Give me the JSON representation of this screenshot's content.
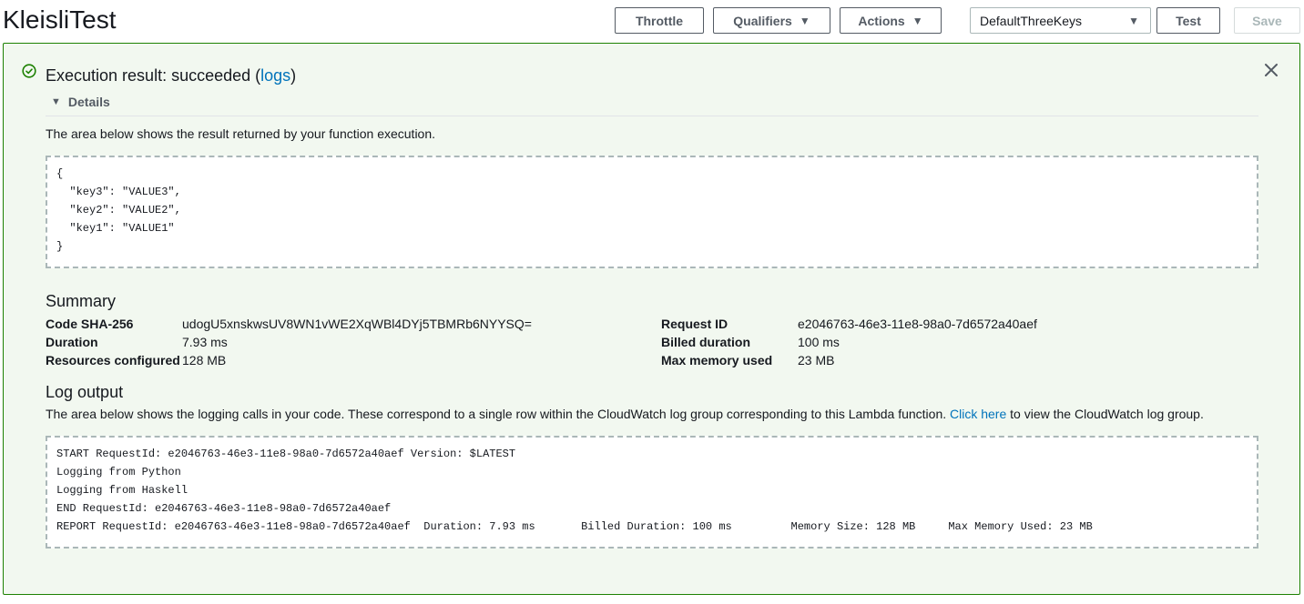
{
  "header": {
    "title": "KleisliTest",
    "throttle_label": "Throttle",
    "qualifiers_label": "Qualifiers",
    "actions_label": "Actions",
    "test_event_selected": "DefaultThreeKeys",
    "test_label": "Test",
    "save_label": "Save"
  },
  "result": {
    "title_prefix": "Execution result: succeeded (",
    "logs_link": "logs",
    "title_suffix": ")",
    "details_label": "Details",
    "status_color": "#1d8102",
    "description": "The area below shows the result returned by your function execution.",
    "output_lines": [
      "{",
      "  \"key3\": \"VALUE3\",",
      "  \"key2\": \"VALUE2\",",
      "  \"key1\": \"VALUE1\"",
      "}"
    ]
  },
  "summary": {
    "title": "Summary",
    "left": [
      {
        "key": "Code SHA-256",
        "value": "udogU5xnskwsUV8WN1vWE2XqWBl4DYj5TBMRb6NYYSQ="
      },
      {
        "key": "Duration",
        "value": "7.93 ms"
      },
      {
        "key": "Resources configured",
        "value": "128 MB"
      }
    ],
    "right": [
      {
        "key": "Request ID",
        "value": "e2046763-46e3-11e8-98a0-7d6572a40aef"
      },
      {
        "key": "Billed duration",
        "value": "100 ms"
      },
      {
        "key": "Max memory used",
        "value": "23 MB"
      }
    ]
  },
  "log_output": {
    "title": "Log output",
    "description_prefix": "The area below shows the logging calls in your code. These correspond to a single row within the CloudWatch log group corresponding to this Lambda function. ",
    "link_text": "Click here",
    "description_suffix": " to view the CloudWatch log group.",
    "lines": [
      "START RequestId: e2046763-46e3-11e8-98a0-7d6572a40aef Version: $LATEST",
      "Logging from Python",
      "Logging from Haskell",
      "END RequestId: e2046763-46e3-11e8-98a0-7d6572a40aef",
      "REPORT RequestId: e2046763-46e3-11e8-98a0-7d6572a40aef  Duration: 7.93 ms       Billed Duration: 100 ms         Memory Size: 128 MB     Max Memory Used: 23 MB"
    ]
  },
  "icons": {
    "status": "check-circle-icon",
    "close": "close-icon",
    "caret": "caret-down-icon",
    "expand": "caret-down-filled-icon"
  }
}
